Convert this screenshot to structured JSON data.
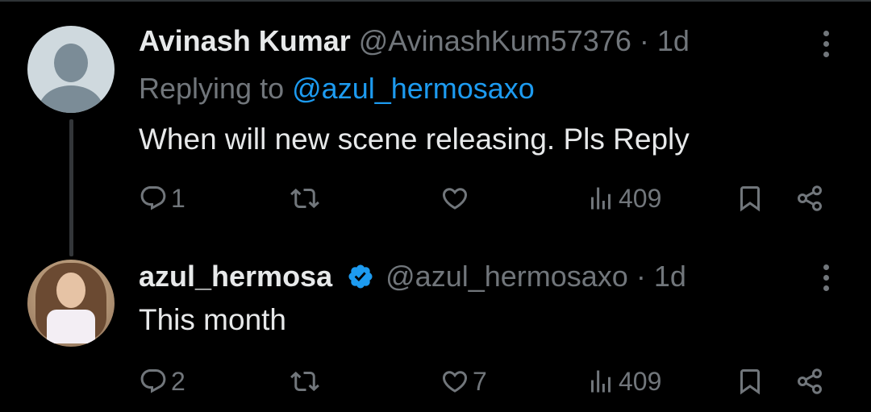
{
  "tweets": [
    {
      "display_name": "Avinash Kumar",
      "handle": "@AvinashKum57376",
      "separator": "·",
      "time": "1d",
      "replying_prefix": "Replying to",
      "replying_to": "@azul_hermosaxo",
      "text": "When will new scene releasing. Pls Reply",
      "verified": false,
      "actions": {
        "replies": "1",
        "retweets": "",
        "likes": "",
        "views": "409"
      }
    },
    {
      "display_name": "azul_hermosa",
      "handle": "@azul_hermosaxo",
      "separator": "·",
      "time": "1d",
      "text": "This month",
      "verified": true,
      "actions": {
        "replies": "2",
        "retweets": "",
        "likes": "7",
        "views": "409"
      }
    }
  ],
  "colors": {
    "background": "#000000",
    "text": "#e7e9ea",
    "secondary": "#71767b",
    "link": "#1d9bf0",
    "verified": "#1d9bf0"
  },
  "icons": {
    "reply": "reply-icon",
    "retweet": "retweet-icon",
    "like": "heart-icon",
    "views": "views-icon",
    "bookmark": "bookmark-icon",
    "share": "share-icon",
    "more": "more-icon",
    "verified": "verified-badge-icon"
  }
}
